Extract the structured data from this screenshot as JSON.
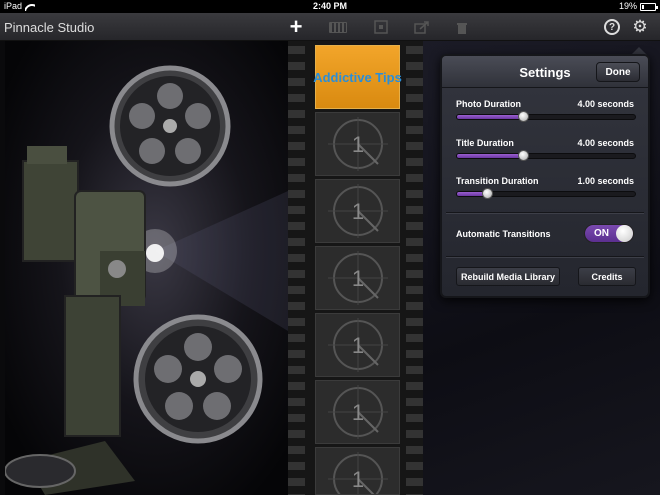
{
  "status_bar": {
    "device": "iPad",
    "time": "2:40 PM",
    "battery": "19%",
    "battery_level": 0.19
  },
  "toolbar": {
    "title": "Pinnacle Studio",
    "icons": [
      "add-icon",
      "film-clip-icon",
      "edit-icon",
      "share-icon",
      "trash-icon",
      "help-icon",
      "gear-icon"
    ]
  },
  "filmstrip": {
    "title_clip_text": "Addictive Tips",
    "countdown_label": "1"
  },
  "settings": {
    "title": "Settings",
    "done_label": "Done",
    "photo_duration": {
      "label": "Photo Duration",
      "value": "4.00 seconds",
      "level": 0.37
    },
    "title_duration": {
      "label": "Title Duration",
      "value": "4.00 seconds",
      "level": 0.37
    },
    "transition_duration": {
      "label": "Transition Duration",
      "value": "1.00 seconds",
      "level": 0.17
    },
    "auto_transitions": {
      "label": "Automatic Transitions",
      "state": "ON"
    },
    "rebuild_label": "Rebuild Media Library",
    "credits_label": "Credits"
  },
  "colors": {
    "accent": "#6a37a0",
    "title_clip_bg": "#f2a52a",
    "title_clip_text": "#2a8ed8"
  }
}
